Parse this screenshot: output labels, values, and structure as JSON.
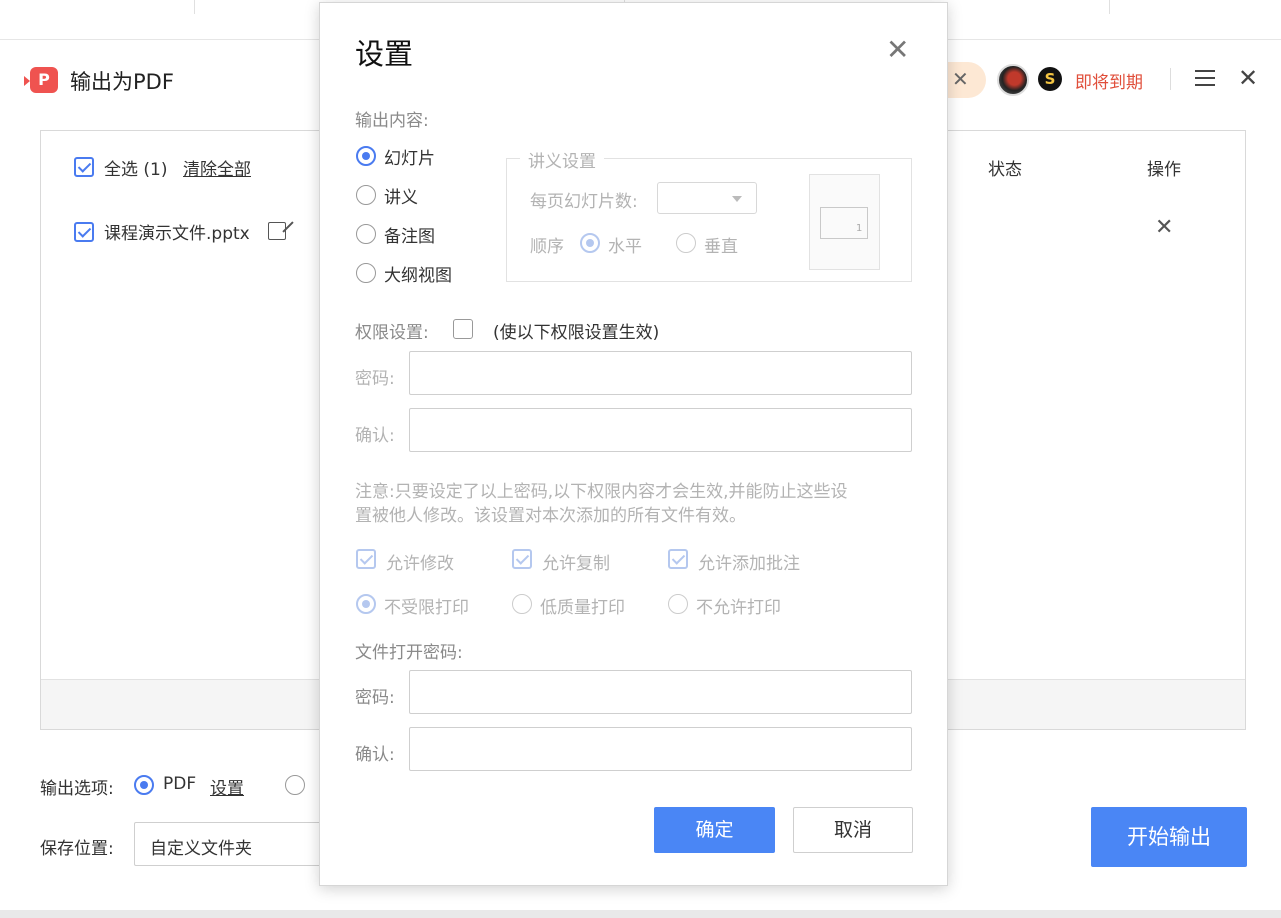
{
  "main": {
    "title": "输出为PDF",
    "logo_glyph": "P",
    "expire_text": "即将到期",
    "select_all": "全选 (1)",
    "clear_all": "清除全部",
    "col_status": "状态",
    "col_action": "操作",
    "file_name": "课程演示文件.pptx",
    "output_option_label": "输出选项:",
    "output_pdf": "PDF",
    "settings_link": "设置",
    "save_location_label": "保存位置:",
    "save_location_value": "自定义文件夹",
    "start_button": "开始输出"
  },
  "dialog": {
    "title": "设置",
    "output_content_label": "输出内容:",
    "content_options": [
      "幻灯片",
      "讲义",
      "备注图",
      "大纲视图"
    ],
    "handout_legend": "讲义设置",
    "slides_per_page_label": "每页幻灯片数:",
    "order_label": "顺序",
    "order_horizontal": "水平",
    "order_vertical": "垂直",
    "preview_number": "1",
    "permission_label": "权限设置:",
    "permission_hint": "(使以下权限设置生效)",
    "password_label": "密码:",
    "confirm_label": "确认:",
    "note_line1": "注意:只要设定了以上密码,以下权限内容才会生效,并能防止这些设",
    "note_line2": "置被他人修改。该设置对本次添加的所有文件有效。",
    "allow_modify": "允许修改",
    "allow_copy": "允许复制",
    "allow_annotate": "允许添加批注",
    "print_unrestricted": "不受限打印",
    "print_low": "低质量打印",
    "print_none": "不允许打印",
    "open_password_label": "文件打开密码:",
    "open_password_field": "密码:",
    "open_confirm_field": "确认:",
    "ok_button": "确定",
    "cancel_button": "取消"
  },
  "colors": {
    "accent": "#4a86f5",
    "expire": "#e04e3a",
    "logo": "#ef5350"
  }
}
